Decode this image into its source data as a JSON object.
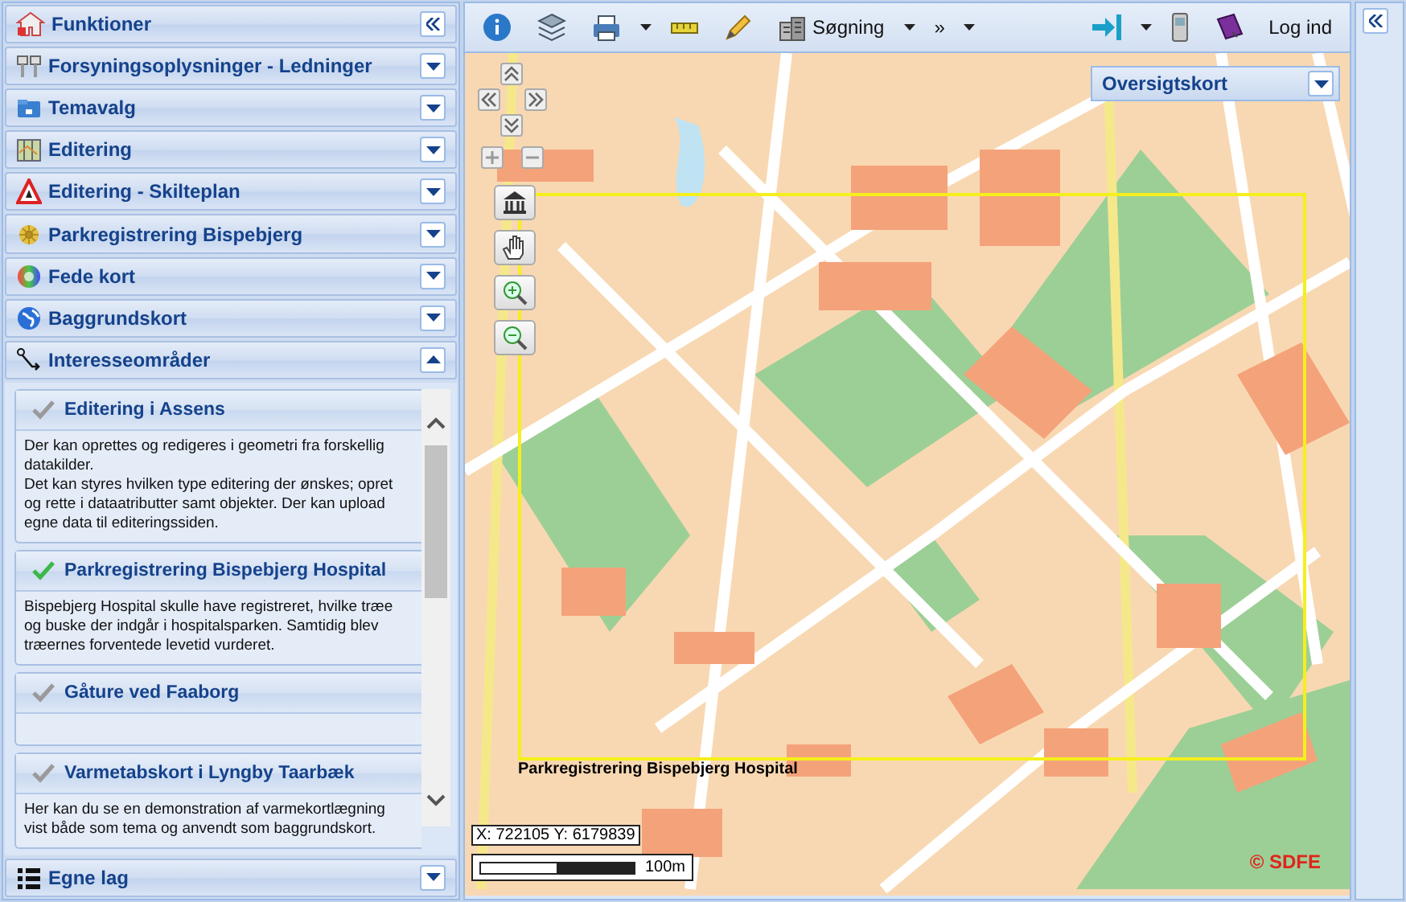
{
  "sidebar": {
    "title": "Funktioner",
    "sections": [
      {
        "label": "Forsyningsoplysninger - Ledninger",
        "kind": "pipes",
        "expanded": false
      },
      {
        "label": "Temavalg",
        "kind": "folder",
        "expanded": false
      },
      {
        "label": "Editering",
        "kind": "map",
        "expanded": false
      },
      {
        "label": "Editering - Skilteplan",
        "kind": "sign",
        "expanded": false
      },
      {
        "label": "Parkregistrering Bispebjerg",
        "kind": "flower",
        "expanded": false
      },
      {
        "label": "Fede kort",
        "kind": "colorwheel",
        "expanded": false
      },
      {
        "label": "Baggrundskort",
        "kind": "globe",
        "expanded": false
      },
      {
        "label": "Interesseområder",
        "kind": "route",
        "expanded": true
      }
    ],
    "interest_items": [
      {
        "title": "Editering i Assens",
        "selected": false,
        "lines": [
          "Der kan oprettes og redigeres i geometri fra forskellig",
          "datakilder.",
          "Det kan styres hvilken type editering der ønskes; opret",
          "og rette i dataatributter samt objekter. Der kan upload",
          "egne data til editeringssiden."
        ]
      },
      {
        "title": "Parkregistrering Bispebjerg Hospital",
        "selected": true,
        "lines": [
          "Bispebjerg Hospital skulle have registreret, hvilke træe",
          "og buske der indgår i hospitalsparken. Samtidig blev",
          "træernes forventede levetid vurderet."
        ]
      },
      {
        "title": "Gåture ved Faaborg",
        "selected": false
      },
      {
        "title": "Varmetabskort i Lyngby Taarbæk",
        "selected": false,
        "lines": [
          "Her kan du se en demonstration af varmekortlægning",
          "vist både som tema og anvendt som baggrundskort."
        ]
      }
    ],
    "footer_section": {
      "label": "Egne lag",
      "kind": "list",
      "expanded": false
    }
  },
  "toolbar": {
    "search_label": "Søgning",
    "more_label": "»",
    "login_label": "Log ind"
  },
  "map": {
    "overview_title": "Oversigtskort",
    "area_label": "Parkregistrering Bispebjerg Hospital",
    "coordinates": "X: 722105 Y: 6179839",
    "scale_label": "100m",
    "copyright": "© SDFE"
  }
}
